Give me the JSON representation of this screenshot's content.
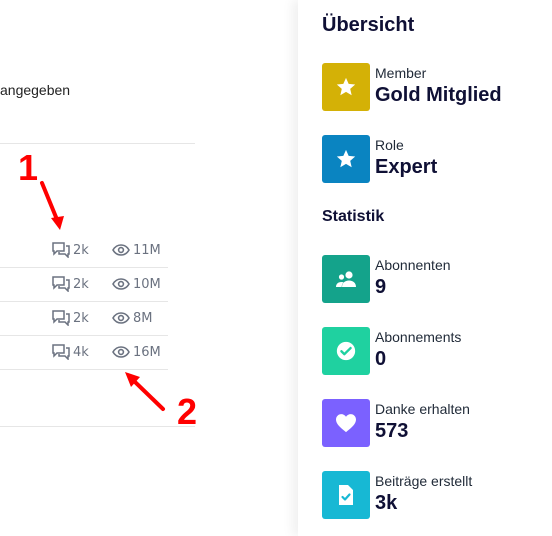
{
  "left": {
    "unspecified_text": "angegeben",
    "rows": [
      {
        "replies": "2k",
        "views": "11M"
      },
      {
        "replies": "2k",
        "views": "10M"
      },
      {
        "replies": "2k",
        "views": "8M"
      },
      {
        "replies": "4k",
        "views": "16M"
      }
    ]
  },
  "annotations": {
    "marker_1": "1",
    "marker_2": "2",
    "color": "#ff0000"
  },
  "sidebar": {
    "overview_title": "Übersicht",
    "member": {
      "label": "Member",
      "value": "Gold Mitglied",
      "color": "#d4b106",
      "icon": "star-icon"
    },
    "role": {
      "label": "Role",
      "value": "Expert",
      "color": "#0a84c1",
      "icon": "star-icon"
    },
    "statistics_title": "Statistik",
    "followers": {
      "label": "Abonnenten",
      "value": "9",
      "color": "#14a38b",
      "icon": "users-icon"
    },
    "subscriptions": {
      "label": "Abonnements",
      "value": "0",
      "color": "#1fd1a0",
      "icon": "check-circle-icon"
    },
    "thanks": {
      "label": "Danke erhalten",
      "value": "573",
      "color": "#7b61ff",
      "icon": "heart-icon"
    },
    "posts": {
      "label": "Beiträge erstellt",
      "value": "3k",
      "color": "#17b8d4",
      "icon": "document-check-icon"
    }
  }
}
